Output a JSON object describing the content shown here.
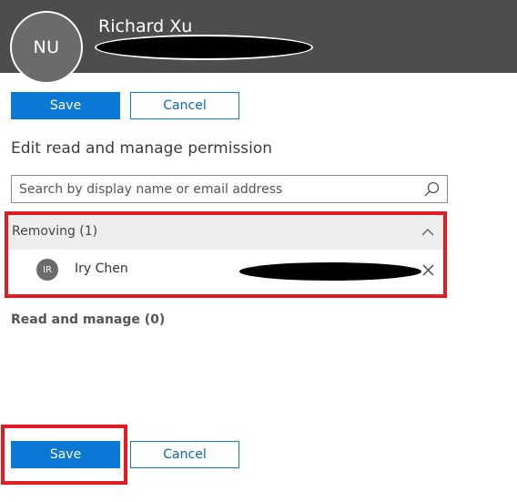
{
  "header": {
    "avatar_initials": "NU",
    "user_name": "Richard Xu"
  },
  "top_actions": {
    "save_label": "Save",
    "cancel_label": "Cancel"
  },
  "section_title": "Edit read and manage permission",
  "search": {
    "placeholder": "Search by display name or email address",
    "value": ""
  },
  "removing_group": {
    "label": "Removing (1)",
    "members": [
      {
        "initials": "IR",
        "name": "Iry Chen"
      }
    ]
  },
  "read_manage": {
    "label": "Read and manage (0)"
  },
  "bottom_actions": {
    "save_label": "Save",
    "cancel_label": "Cancel"
  },
  "colors": {
    "header_bg": "#4d4d4d",
    "primary": "#0a78d4",
    "highlight": "#e31b23"
  },
  "icons": [
    "search-icon",
    "chevron-up-icon",
    "close-icon"
  ]
}
